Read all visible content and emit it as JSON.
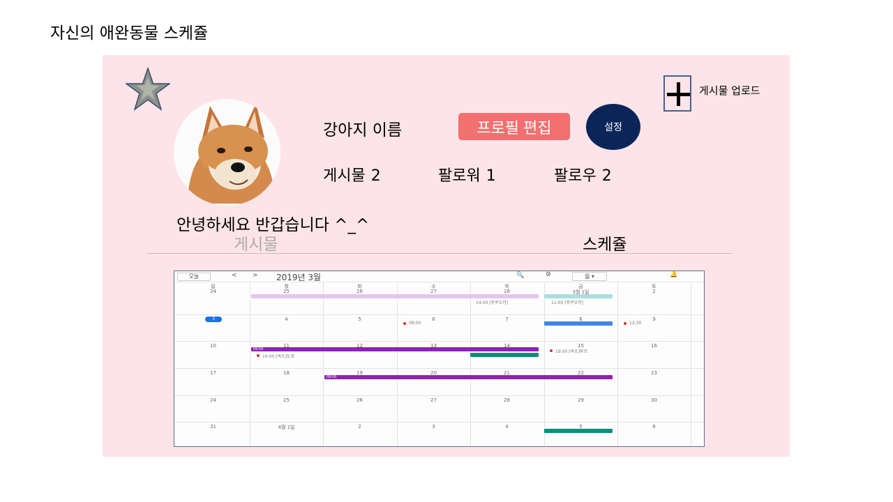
{
  "slide": {
    "title": "자신의 애완동물 스케쥴"
  },
  "profile": {
    "name": "강아지 이름",
    "edit_button": "프로필 편집",
    "settings_button": "설정",
    "bio": "안녕하세요 반갑습니다 ^_^",
    "stats": [
      {
        "label": "게시물",
        "value": "2"
      },
      {
        "label": "팔로워",
        "value": "1"
      },
      {
        "label": "팔로우",
        "value": "2"
      }
    ]
  },
  "upload": {
    "label": "게시물 업로드"
  },
  "tabs": {
    "posts": "게시물",
    "schedule": "스케쥴"
  },
  "calendar": {
    "today_button": "오늘",
    "prev": "<",
    "next": ">",
    "month": "2019년 3월",
    "view": "월 ▾",
    "weekdays": [
      "일",
      "월",
      "화",
      "수",
      "목",
      "금",
      "토"
    ],
    "rows": [
      [
        "24",
        "25",
        "26",
        "27",
        "28",
        "3월 1일",
        "2"
      ],
      [
        "3",
        "4",
        "5",
        "6",
        "7",
        "8",
        "9"
      ],
      [
        "10",
        "11",
        "12",
        "13",
        "14",
        "15",
        "16"
      ],
      [
        "17",
        "18",
        "19",
        "20",
        "21",
        "22",
        "23"
      ],
      [
        "24",
        "25",
        "26",
        "27",
        "28",
        "29",
        "30"
      ],
      [
        "31",
        "4월 1일",
        "2",
        "3",
        "4",
        "5",
        "6"
      ]
    ],
    "events": {
      "e1": "09:00",
      "e2": "09:00",
      "e3": "10:00 [속소]도쿄",
      "e4": "08:00",
      "e5": "12:30",
      "e6": "19:00 [속소]루프",
      "e7": "11:00 [후쿠오카]",
      "e8": "14:00 [후쿠오카]"
    },
    "colors": {
      "purple": "#8e24aa",
      "light_purple": "#d7aee8",
      "teal": "#0b8f7a",
      "blue": "#3f86e6",
      "mint": "#a9dfdc"
    }
  }
}
